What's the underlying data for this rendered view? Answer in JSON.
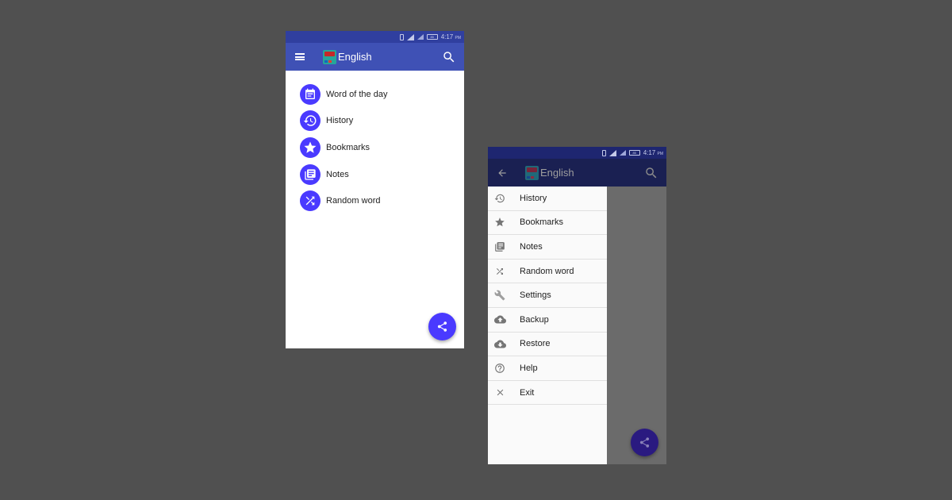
{
  "status_bar": {
    "time": "4:17",
    "ampm": "PM",
    "battery_label": "85"
  },
  "app": {
    "title": "English"
  },
  "home": {
    "items": [
      {
        "label": "Word of the day",
        "icon": "calendar-icon"
      },
      {
        "label": "History",
        "icon": "history-icon"
      },
      {
        "label": "Bookmarks",
        "icon": "star-icon"
      },
      {
        "label": "Notes",
        "icon": "notes-icon"
      },
      {
        "label": "Random word",
        "icon": "shuffle-icon"
      }
    ],
    "fab_icon": "share-icon"
  },
  "drawer": {
    "items": [
      {
        "label": "History",
        "icon": "history-icon"
      },
      {
        "label": "Bookmarks",
        "icon": "star-icon"
      },
      {
        "label": "Notes",
        "icon": "notes-icon"
      },
      {
        "label": "Random word",
        "icon": "shuffle-icon"
      },
      {
        "label": "Settings",
        "icon": "wrench-icon"
      },
      {
        "label": "Backup",
        "icon": "cloud-upload-icon"
      },
      {
        "label": "Restore",
        "icon": "cloud-download-icon"
      },
      {
        "label": "Help",
        "icon": "help-icon"
      },
      {
        "label": "Exit",
        "icon": "close-icon"
      }
    ]
  },
  "colors": {
    "primary": "#3f51b5",
    "primary_dark": "#303f9f",
    "accent": "#4a3aff"
  }
}
